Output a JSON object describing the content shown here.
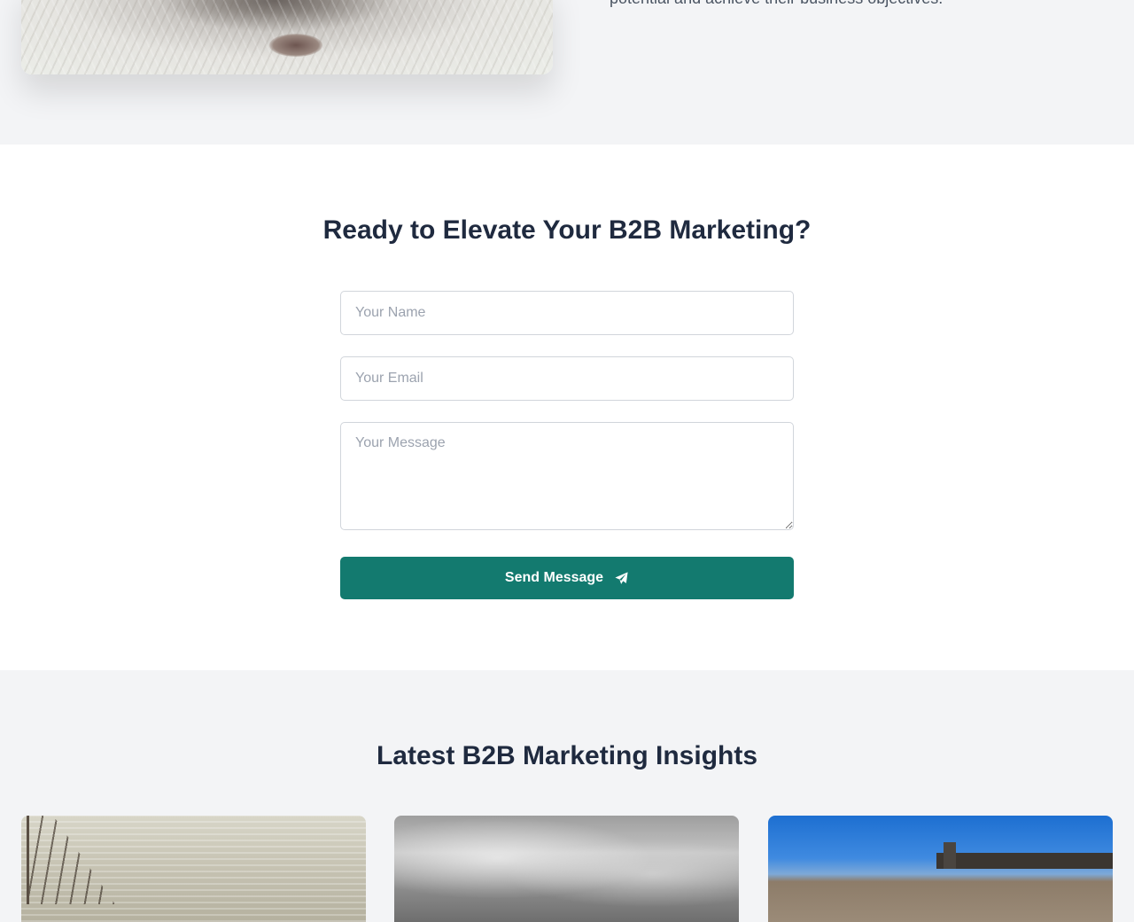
{
  "about": {
    "text": "potential and achieve their business objectives."
  },
  "contact": {
    "heading": "Ready to Elevate Your B2B Marketing?",
    "name_placeholder": "Your Name",
    "email_placeholder": "Your Email",
    "message_placeholder": "Your Message",
    "send_label": "Send Message",
    "send_icon": "paper-plane-icon",
    "accent": "#137a6f"
  },
  "insights": {
    "heading": "Latest B2B Marketing Insights"
  },
  "colors": {
    "page_bg": "#f3f4f6",
    "heading": "#1f2a3f"
  }
}
